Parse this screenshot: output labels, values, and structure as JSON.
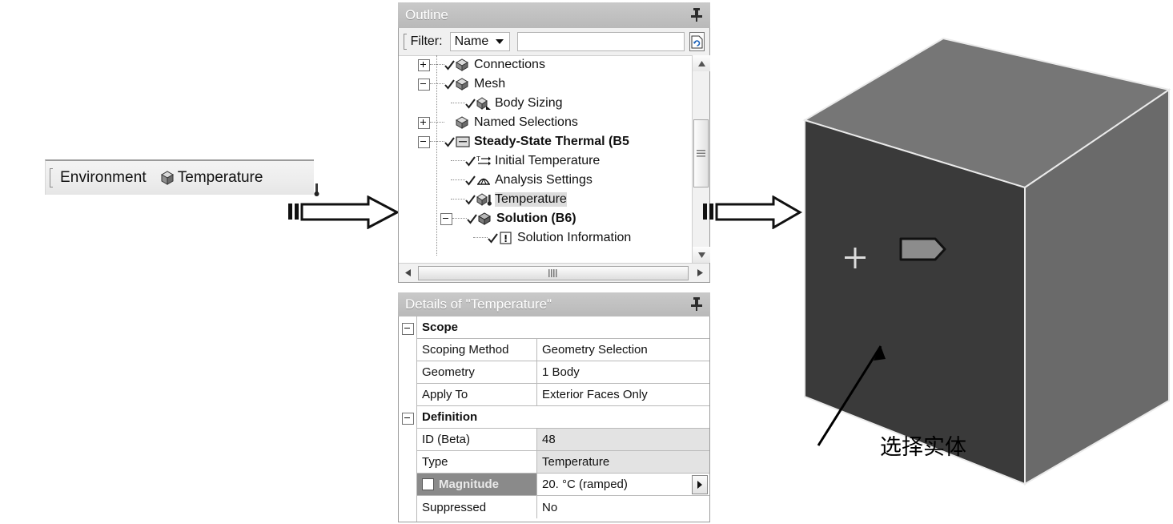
{
  "toolbar": {
    "environment_label": "Environment",
    "temperature_label": "Temperature",
    "cube_icon": "cube-icon",
    "thermometer_icon": "thermometer-icon"
  },
  "outline": {
    "title": "Outline",
    "pin_icon": "pushpin-icon",
    "filter": {
      "label": "Filter:",
      "combo_value": "Name",
      "combo_options": [
        "Name"
      ],
      "text_value": "",
      "text_placeholder": "",
      "refresh_icon": "refresh-icon",
      "dropdown_icon": "chevron-down-icon"
    },
    "tree": [
      {
        "label": "Connections",
        "indent": 1,
        "toggle": "plus",
        "check": true,
        "icon": "cube-icon",
        "bold": false,
        "selected": false
      },
      {
        "label": "Mesh",
        "indent": 1,
        "toggle": "minus",
        "check": true,
        "icon": "cube-icon",
        "bold": false,
        "selected": false
      },
      {
        "label": "Body Sizing",
        "indent": 2,
        "toggle": "none",
        "check": true,
        "icon": "body-sizing-icon",
        "bold": false,
        "selected": false
      },
      {
        "label": "Named Selections",
        "indent": 1,
        "toggle": "plus",
        "check": false,
        "icon": "cube-icon",
        "bold": false,
        "selected": false
      },
      {
        "label": "Steady-State Thermal (B5",
        "indent": 1,
        "toggle": "minus",
        "check": true,
        "icon": "folder-icon",
        "bold": true,
        "selected": false
      },
      {
        "label": "Initial Temperature",
        "indent": 2,
        "toggle": "none",
        "check": true,
        "icon": "initial-temp-icon",
        "bold": false,
        "selected": false
      },
      {
        "label": "Analysis Settings",
        "indent": 2,
        "toggle": "none",
        "check": true,
        "icon": "analysis-settings-icon",
        "bold": false,
        "selected": false
      },
      {
        "label": "Temperature",
        "indent": 2,
        "toggle": "none",
        "check": true,
        "icon": "temperature-icon",
        "bold": false,
        "selected": true
      },
      {
        "label": "Solution (B6)",
        "indent": 2,
        "toggle": "minus",
        "check": true,
        "icon": "solution-icon",
        "bold": true,
        "selected": false
      },
      {
        "label": "Solution Information",
        "indent": 3,
        "toggle": "none",
        "check": true,
        "icon": "solution-info-icon",
        "bold": false,
        "selected": false
      }
    ],
    "scroll_up_icon": "scroll-up-arrow-icon",
    "scroll_down_icon": "scroll-down-arrow-icon",
    "scroll_left_icon": "scroll-left-arrow-icon",
    "scroll_right_icon": "scroll-right-arrow-icon"
  },
  "details": {
    "title": "Details of \"Temperature\"",
    "pin_icon": "pushpin-icon",
    "rows": [
      {
        "kind": "group",
        "key": "Scope",
        "value": "",
        "shaded": false,
        "highlight": false,
        "checkbox": false,
        "dropdown": false
      },
      {
        "kind": "prop",
        "key": "Scoping Method",
        "value": "Geometry Selection",
        "shaded": false,
        "highlight": false,
        "checkbox": false,
        "dropdown": false
      },
      {
        "kind": "prop",
        "key": "Geometry",
        "value": "1 Body",
        "shaded": false,
        "highlight": false,
        "checkbox": false,
        "dropdown": false
      },
      {
        "kind": "prop",
        "key": "Apply To",
        "value": "Exterior Faces Only",
        "shaded": false,
        "highlight": false,
        "checkbox": false,
        "dropdown": false
      },
      {
        "kind": "group",
        "key": "Definition",
        "value": "",
        "shaded": false,
        "highlight": false,
        "checkbox": false,
        "dropdown": false
      },
      {
        "kind": "prop",
        "key": "ID (Beta)",
        "value": "48",
        "shaded": true,
        "highlight": false,
        "checkbox": false,
        "dropdown": false
      },
      {
        "kind": "prop",
        "key": "Type",
        "value": "Temperature",
        "shaded": true,
        "highlight": false,
        "checkbox": false,
        "dropdown": false
      },
      {
        "kind": "prop",
        "key": "Magnitude",
        "value": "20. °C  (ramped)",
        "shaded": false,
        "highlight": true,
        "checkbox": true,
        "dropdown": true
      },
      {
        "kind": "prop",
        "key": "Suppressed",
        "value": "No",
        "shaded": false,
        "highlight": false,
        "checkbox": false,
        "dropdown": false
      }
    ]
  },
  "arrows": {
    "left_arrow_name": "step-arrow-1",
    "right_arrow_name": "step-arrow-2"
  },
  "viewport": {
    "annotation_text": "选择实体",
    "cursor_icon": "crosshair-cursor-icon",
    "tag_icon": "selection-tag-icon",
    "model_name": "box-solid-model",
    "colors": {
      "front_face": "#3a3a3a",
      "top_face": "#767676",
      "right_face": "#6a6a6a",
      "edge": "#e8e8e8"
    }
  }
}
